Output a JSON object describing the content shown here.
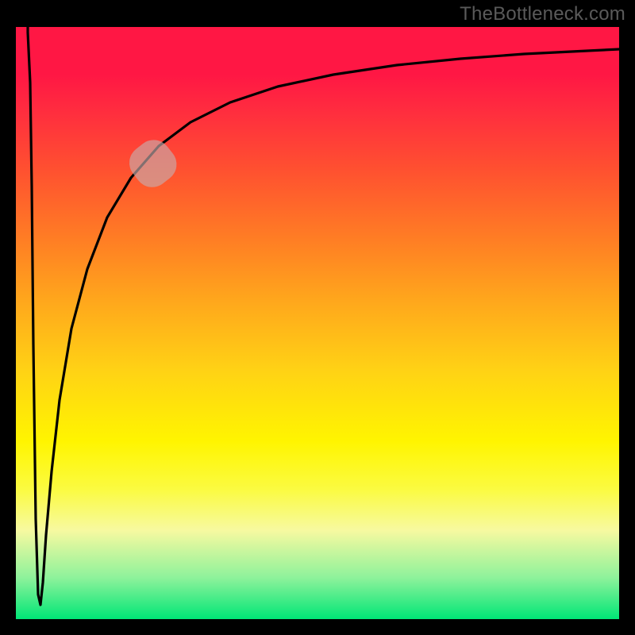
{
  "watermark": "TheBottleneck.com",
  "chart_data": {
    "type": "line",
    "title": "",
    "xlabel": "",
    "ylabel": "",
    "xlim": [
      0,
      100
    ],
    "ylim": [
      0,
      100
    ],
    "background_gradient": {
      "top": "#ff1744",
      "mid": "#fff500",
      "bottom": "#00e676"
    },
    "series": [
      {
        "name": "curve",
        "x": [
          2,
          3,
          4,
          5,
          6,
          8,
          10,
          12,
          14,
          16,
          20,
          25,
          30,
          35,
          40,
          50,
          60,
          70,
          80,
          90,
          100
        ],
        "y": [
          99,
          40,
          8,
          25,
          40,
          55,
          64,
          70,
          74,
          78,
          82,
          86,
          88.5,
          90,
          91,
          92.5,
          93.5,
          94.2,
          94.8,
          95.3,
          95.7
        ]
      }
    ],
    "marker_region": {
      "x_start": 20,
      "x_end": 27,
      "y_start": 72,
      "y_end": 79
    },
    "annotations": []
  }
}
